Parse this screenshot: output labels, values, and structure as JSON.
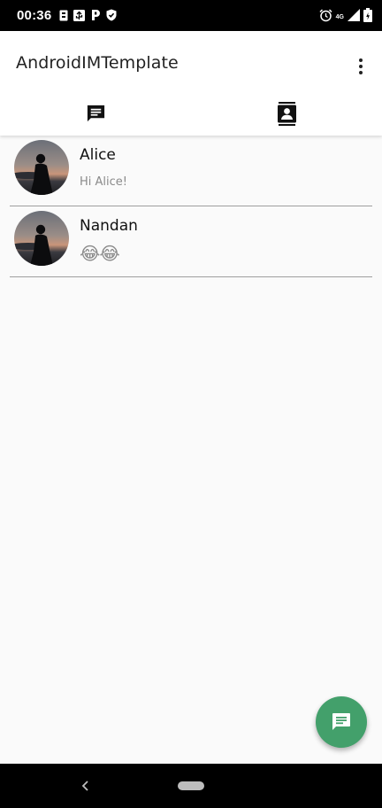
{
  "status_bar": {
    "time": "00:36",
    "left_icons": [
      "sim-icon",
      "usb-icon",
      "parking-icon",
      "shield-icon"
    ],
    "right_icons": [
      "alarm-icon",
      "signal-4g-icon",
      "signal-icon",
      "battery-icon"
    ],
    "network_label": "4G"
  },
  "app_bar": {
    "title": "AndroidIMTemplate",
    "overflow_icon": "more-vert-icon"
  },
  "tabs": [
    {
      "name": "chats",
      "icon": "chat-icon",
      "active": true
    },
    {
      "name": "contacts",
      "icon": "contacts-icon",
      "active": false
    }
  ],
  "conversations": [
    {
      "name": "Alice",
      "last_message": "Hi Alice!"
    },
    {
      "name": "Nandan",
      "last_message": "😂😂"
    }
  ],
  "fab": {
    "icon": "message-icon"
  },
  "colors": {
    "accent": "#43a06b",
    "status_bar": "#000000",
    "background": "#fafafa"
  }
}
